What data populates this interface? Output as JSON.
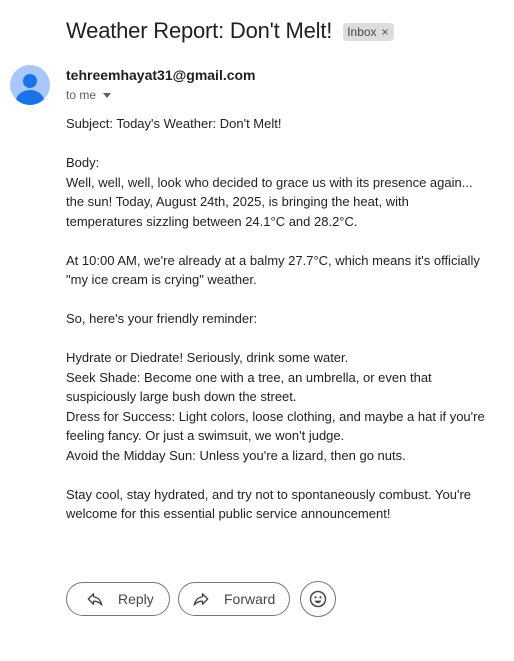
{
  "header": {
    "subject": "Weather Report: Don't Melt!",
    "label_chip": "Inbox",
    "label_remove": "×"
  },
  "message": {
    "sender": "tehreemhayat31@gmail.com",
    "recipient": "to me",
    "body": {
      "subject_line": "Subject: Today's Weather: Don't Melt!",
      "body_label": "Body:",
      "intro": "Well, well, well, look who decided to grace us with its presence again... the sun! Today, August 24th, 2025, is bringing the heat, with temperatures sizzling between 24.1°C and 28.2°C.",
      "current": "At 10:00 AM, we're already at a balmy 27.7°C, which means it's officially \"my ice cream is crying\" weather.",
      "reminder_intro": "So, here's your friendly reminder:",
      "tip_hydrate": "Hydrate or Diedrate! Seriously, drink some water.",
      "tip_shade": "Seek Shade: Become one with a tree, an umbrella, or even that suspiciously large bush down the street.",
      "tip_dress": "Dress for Success: Light colors, loose clothing, and maybe a hat if you're feeling fancy. Or just a swimsuit, we won't judge.",
      "tip_sun": "Avoid the Midday Sun: Unless you're a lizard, then go nuts.",
      "closing": "Stay cool, stay hydrated, and try not to spontaneously combust. You're welcome for this essential public service announcement!"
    }
  },
  "actions": {
    "reply_label": "Reply",
    "forward_label": "Forward"
  },
  "icons": {
    "avatar": "person-avatar-icon",
    "reply": "reply-arrow-icon",
    "forward": "forward-arrow-icon",
    "emoji": "smiley-face-icon",
    "recipient_details": "caret-down-icon"
  },
  "colors": {
    "avatar_bg": "#a8c7fa",
    "avatar_fg": "#1a73e8",
    "chip_bg": "#dddddd"
  }
}
